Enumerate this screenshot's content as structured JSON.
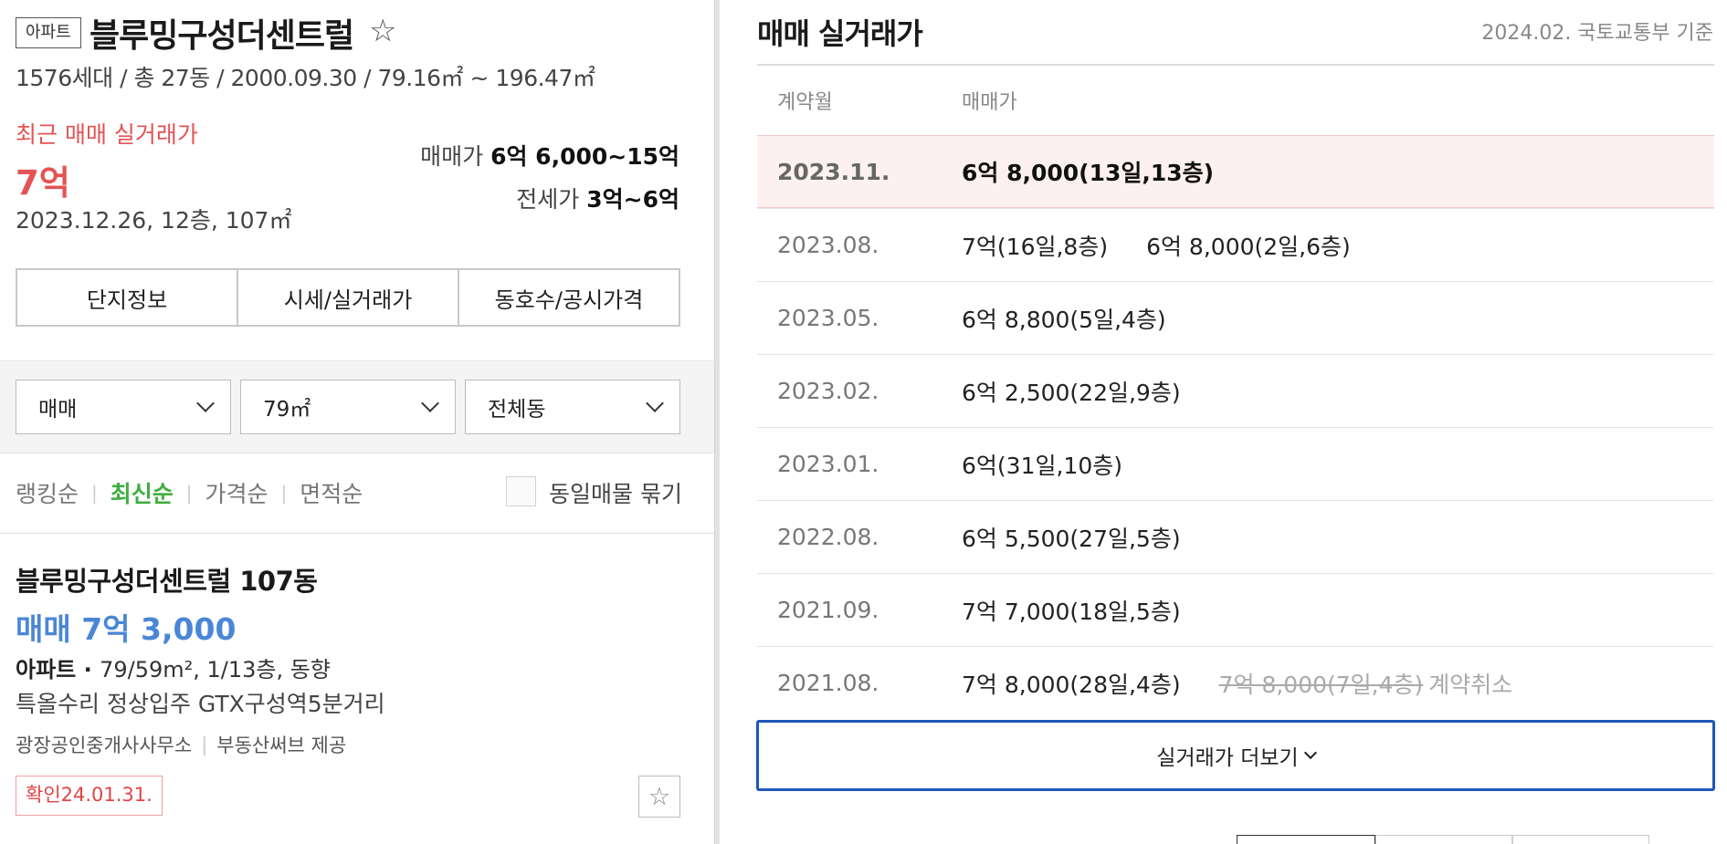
{
  "complex": {
    "type_badge": "아파트",
    "name": "블루밍구성더센트럴",
    "favorite_icon": "☆",
    "meta": "1576세대 / 총 27동 / 2000.09.30 / 79.16㎡ ~ 196.47㎡"
  },
  "recent_trade": {
    "label": "최근 매매 실거래가",
    "price": "7억",
    "detail": "2023.12.26, 12층, 107㎡"
  },
  "price_ranges": {
    "sale_label": "매매가",
    "sale_value": "6억 6,000~15억",
    "jeonse_label": "전세가",
    "jeonse_value": "3억~6억"
  },
  "tabs": [
    "단지정보",
    "시세/실거래가",
    "동호수/공시가격"
  ],
  "filters": {
    "trade_type": "매매",
    "area": "79㎡",
    "building": "전체동"
  },
  "sort": {
    "options": [
      "랭킹순",
      "최신순",
      "가격순",
      "면적순"
    ],
    "active": "최신순",
    "same_listing_label": "동일매물 묶기"
  },
  "listing": {
    "title": "블루밍구성더센트럴 107동",
    "price": "매매 7억 3,000",
    "type": "아파트 · ",
    "spec": "79/59m², 1/13층, 동향",
    "description": "특올수리 정상입주 GTX구성역5분거리",
    "agent": "광장공인중개사사무소",
    "provider": "부동산써브 제공",
    "confirmed": "확인24.01.31.",
    "favorite_icon": "☆"
  },
  "transactions": {
    "title": "매매 실거래가",
    "source": "2024.02. 국토교통부 기준",
    "col_month": "계약월",
    "col_price": "매매가",
    "rows": [
      {
        "month": "2023.11.",
        "deals": [
          "6억 8,000(13일,13층)"
        ]
      },
      {
        "month": "2023.08.",
        "deals": [
          "7억(16일,8층)",
          "6억 8,000(2일,6층)"
        ]
      },
      {
        "month": "2023.05.",
        "deals": [
          "6억 8,800(5일,4층)"
        ]
      },
      {
        "month": "2023.02.",
        "deals": [
          "6억 2,500(22일,9층)"
        ]
      },
      {
        "month": "2023.01.",
        "deals": [
          "6억(31일,10층)"
        ]
      },
      {
        "month": "2022.08.",
        "deals": [
          "6억 5,500(27일,5층)"
        ]
      },
      {
        "month": "2021.09.",
        "deals": [
          "7억 7,000(18일,5층)"
        ]
      },
      {
        "month": "2021.08.",
        "deals": [
          "7억 8,000(28일,4층)"
        ],
        "cancelled": "7억 8,000(7일,4층)",
        "cancel_note": "계약취소"
      }
    ],
    "more_label": "실거래가 더보기"
  },
  "colors": {
    "accent_red": "#e45353",
    "accent_green": "#3fae3f",
    "accent_blue": "#4a86d8",
    "button_border": "#1d57b8"
  }
}
